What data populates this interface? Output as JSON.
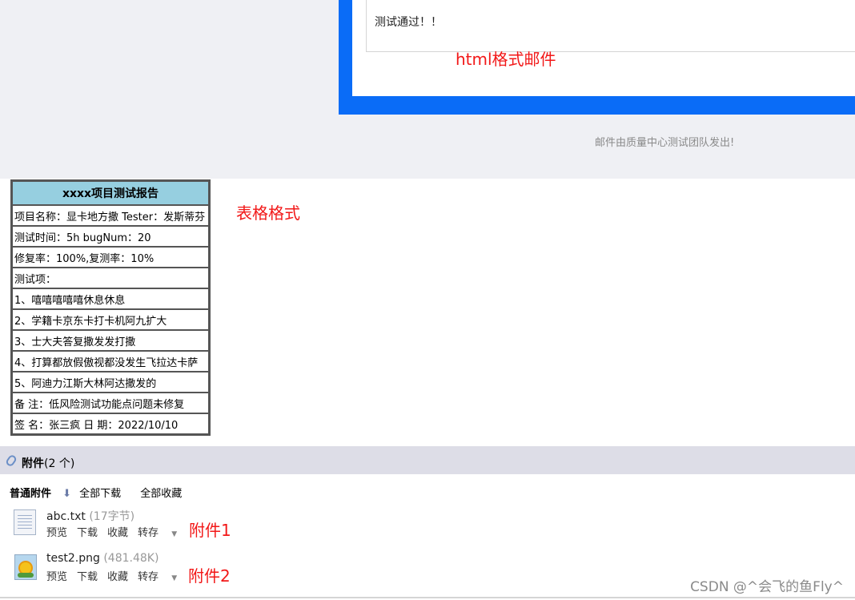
{
  "mail": {
    "pass_text": "测试通过！！",
    "html_note": "html格式邮件",
    "footer": "邮件由质量中心测试团队发出!"
  },
  "report": {
    "title": "xxxx项目测试报告",
    "rows": [
      "项目名称：显卡地方撒 Tester：发斯蒂芬",
      "测试时间：5h bugNum：20",
      "修复率：100%,复测率：10%",
      "测试项：",
      "1、嘻嘻嘻嘻嘻休息休息",
      "2、学籍卡京东卡打卡机阿九扩大",
      "3、士大夫答复撒发发打撒",
      "4、打算都放假傲视都没发生飞拉达卡萨",
      "5、阿迪力江斯大林阿达撒发的",
      "备 注：低风险测试功能点问题未修复",
      "签 名：张三疯 日 期：2022/10/10"
    ],
    "note": "表格格式"
  },
  "attachments": {
    "title": "附件",
    "count": "(2 个)",
    "toolbar": {
      "section": "普通附件",
      "download_all": "全部下载",
      "collect_all": "全部收藏"
    },
    "files": [
      {
        "name": "abc.txt",
        "size": "(17字节)",
        "icon": "text-file-icon",
        "note": "附件1"
      },
      {
        "name": "test2.png",
        "size": "(481.48K)",
        "icon": "image-file-icon",
        "note": "附件2"
      }
    ],
    "actions": {
      "preview": "预览",
      "download": "下载",
      "collect": "收藏",
      "transfer": "转存"
    }
  },
  "watermark": "CSDN @^会飞的鱼Fly^",
  "colors": {
    "frame_blue": "#0a6cf7",
    "header_cyan": "#96cfe0",
    "note_red": "#f21818"
  }
}
